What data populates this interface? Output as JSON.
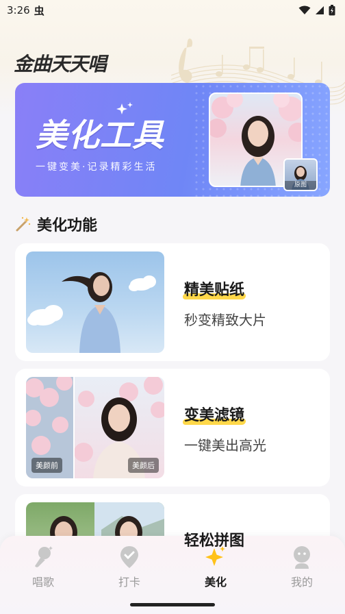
{
  "status_bar": {
    "time": "3:26",
    "notification_glyph": "虫"
  },
  "app_title": "金曲天天唱",
  "banner": {
    "title": "美化工具",
    "subtitle": "一键变美·记录精彩生活",
    "thumb_label": "原图"
  },
  "section": {
    "title": "美化功能",
    "icon": "magic-wand-icon"
  },
  "cards": [
    {
      "title": "精美贴纸",
      "desc": "秒变精致大片"
    },
    {
      "title": "变美滤镜",
      "desc": "一键美出高光",
      "before_label": "美颜前",
      "after_label": "美颜后"
    },
    {
      "title": "轻松拼图",
      "desc": ""
    }
  ],
  "nav": [
    {
      "label": "唱歌",
      "icon": "microphone-icon",
      "active": false
    },
    {
      "label": "打卡",
      "icon": "location-pin-icon",
      "active": false
    },
    {
      "label": "美化",
      "icon": "sparkle-icon",
      "active": true
    },
    {
      "label": "我的",
      "icon": "profile-icon",
      "active": false
    }
  ],
  "colors": {
    "accent": "#ffd84a",
    "banner": "#7d84f6",
    "active_icon": "#ffc21a",
    "inactive": "#c8c8c8"
  }
}
